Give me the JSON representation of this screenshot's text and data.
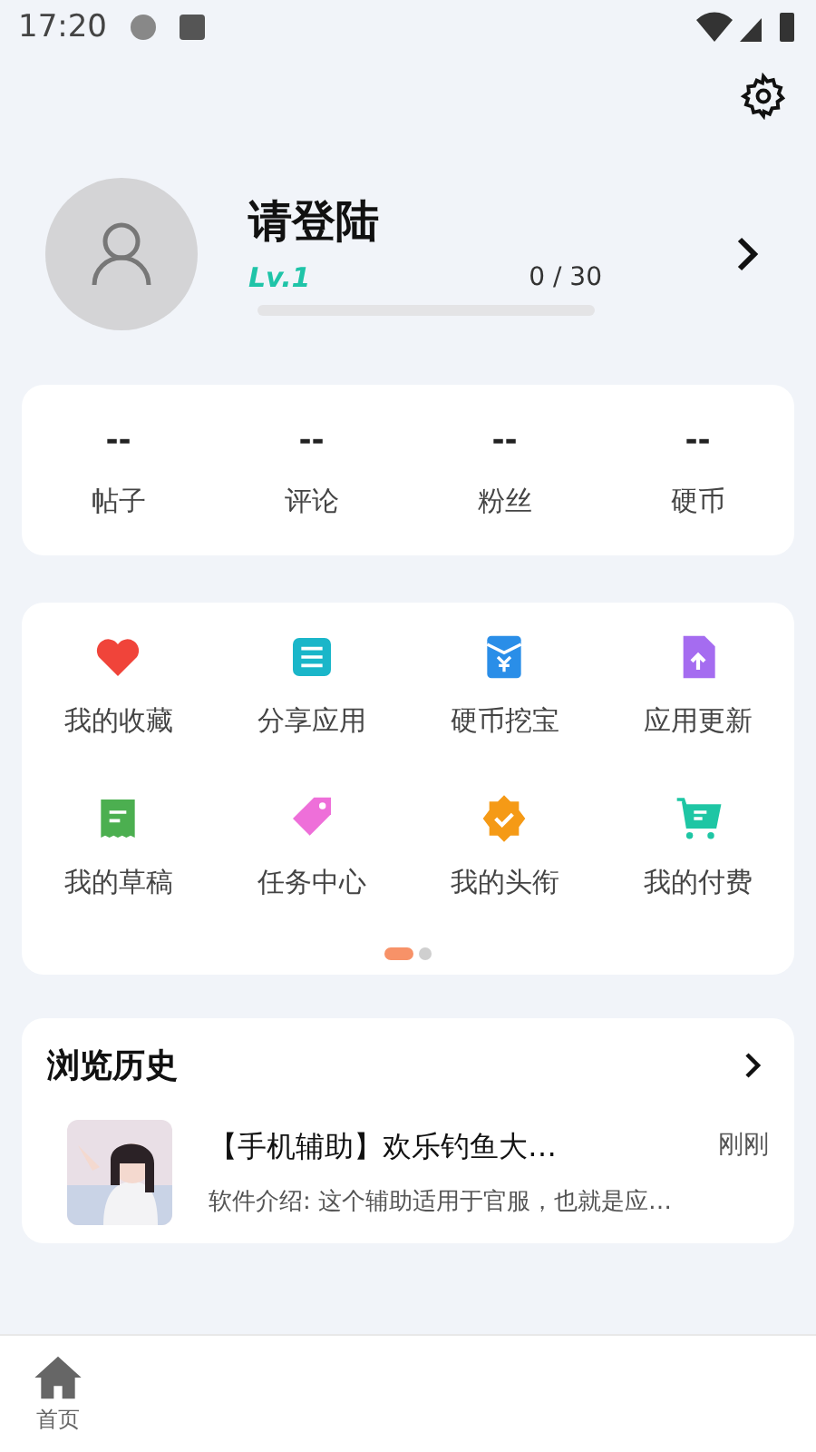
{
  "status_bar": {
    "time": "17:20"
  },
  "profile": {
    "name": "请登陆",
    "level_label": "Lv.1",
    "progress_text": "0 / 30",
    "level": 0
  },
  "stats": [
    {
      "value": "--",
      "label": "帖子"
    },
    {
      "value": "--",
      "label": "评论"
    },
    {
      "value": "--",
      "label": "粉丝"
    },
    {
      "value": "--",
      "label": "硬币"
    }
  ],
  "menu": [
    {
      "kind": "heart",
      "label": "我的收藏",
      "color": "#f0443a"
    },
    {
      "kind": "document",
      "label": "分享应用",
      "color": "#1ab6c9"
    },
    {
      "kind": "envelope",
      "label": "硬币挖宝",
      "color": "#2a8ee8"
    },
    {
      "kind": "upload",
      "label": "应用更新",
      "color": "#a56cf0"
    },
    {
      "kind": "receipt",
      "label": "我的草稿",
      "color": "#4caf50"
    },
    {
      "kind": "tag",
      "label": "任务中心",
      "color": "#ee6fd9"
    },
    {
      "kind": "badge",
      "label": "我的头衔",
      "color": "#f59a16"
    },
    {
      "kind": "cart",
      "label": "我的付费",
      "color": "#1ec6a4"
    }
  ],
  "pager": [
    {
      "selected": true
    },
    {
      "selected": false
    }
  ],
  "history": {
    "title": "浏览历史",
    "items": [
      {
        "title": "【手机辅助】欢乐钓鱼大…",
        "time": "刚刚",
        "summary": "软件介绍: 这个辅助适用于官服，也就是应…"
      }
    ]
  },
  "bottom_nav": [
    {
      "label": "首页",
      "selected": true
    }
  ]
}
